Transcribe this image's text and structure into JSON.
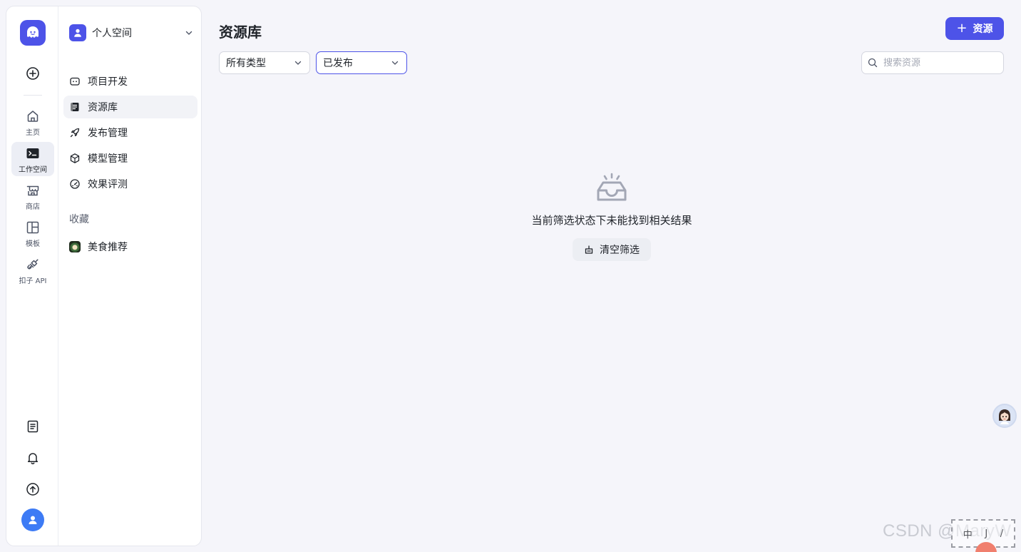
{
  "rail": {
    "items": [
      {
        "label": "主页",
        "icon": "home-icon"
      },
      {
        "label": "工作空间",
        "icon": "terminal-icon"
      },
      {
        "label": "商店",
        "icon": "store-icon"
      },
      {
        "label": "模板",
        "icon": "template-icon"
      },
      {
        "label": "扣子 API",
        "icon": "api-icon"
      }
    ],
    "active": "工作空间"
  },
  "nav": {
    "space_name": "个人空间",
    "items": [
      {
        "label": "项目开发",
        "icon": "robot-icon"
      },
      {
        "label": "资源库",
        "icon": "library-icon"
      },
      {
        "label": "发布管理",
        "icon": "rocket-icon"
      },
      {
        "label": "模型管理",
        "icon": "cube-icon"
      },
      {
        "label": "效果评测",
        "icon": "gauge-icon"
      }
    ],
    "active": "资源库",
    "favorites_title": "收藏",
    "favorites": [
      {
        "label": "美食推荐"
      }
    ]
  },
  "main": {
    "title": "资源库",
    "add_button": "资源",
    "type_filter": "所有类型",
    "status_filter": "已发布",
    "search_placeholder": "搜索资源",
    "empty_message": "当前筛选状态下未能找到相关结果",
    "clear_button": "清空筛选"
  },
  "overlay": {
    "watermark": "CSDN @MaryW",
    "widget_chars": [
      "中",
      "J",
      "/"
    ]
  },
  "colors": {
    "accent": "#4d53e8",
    "avatar_blue": "#3d7bf5"
  }
}
